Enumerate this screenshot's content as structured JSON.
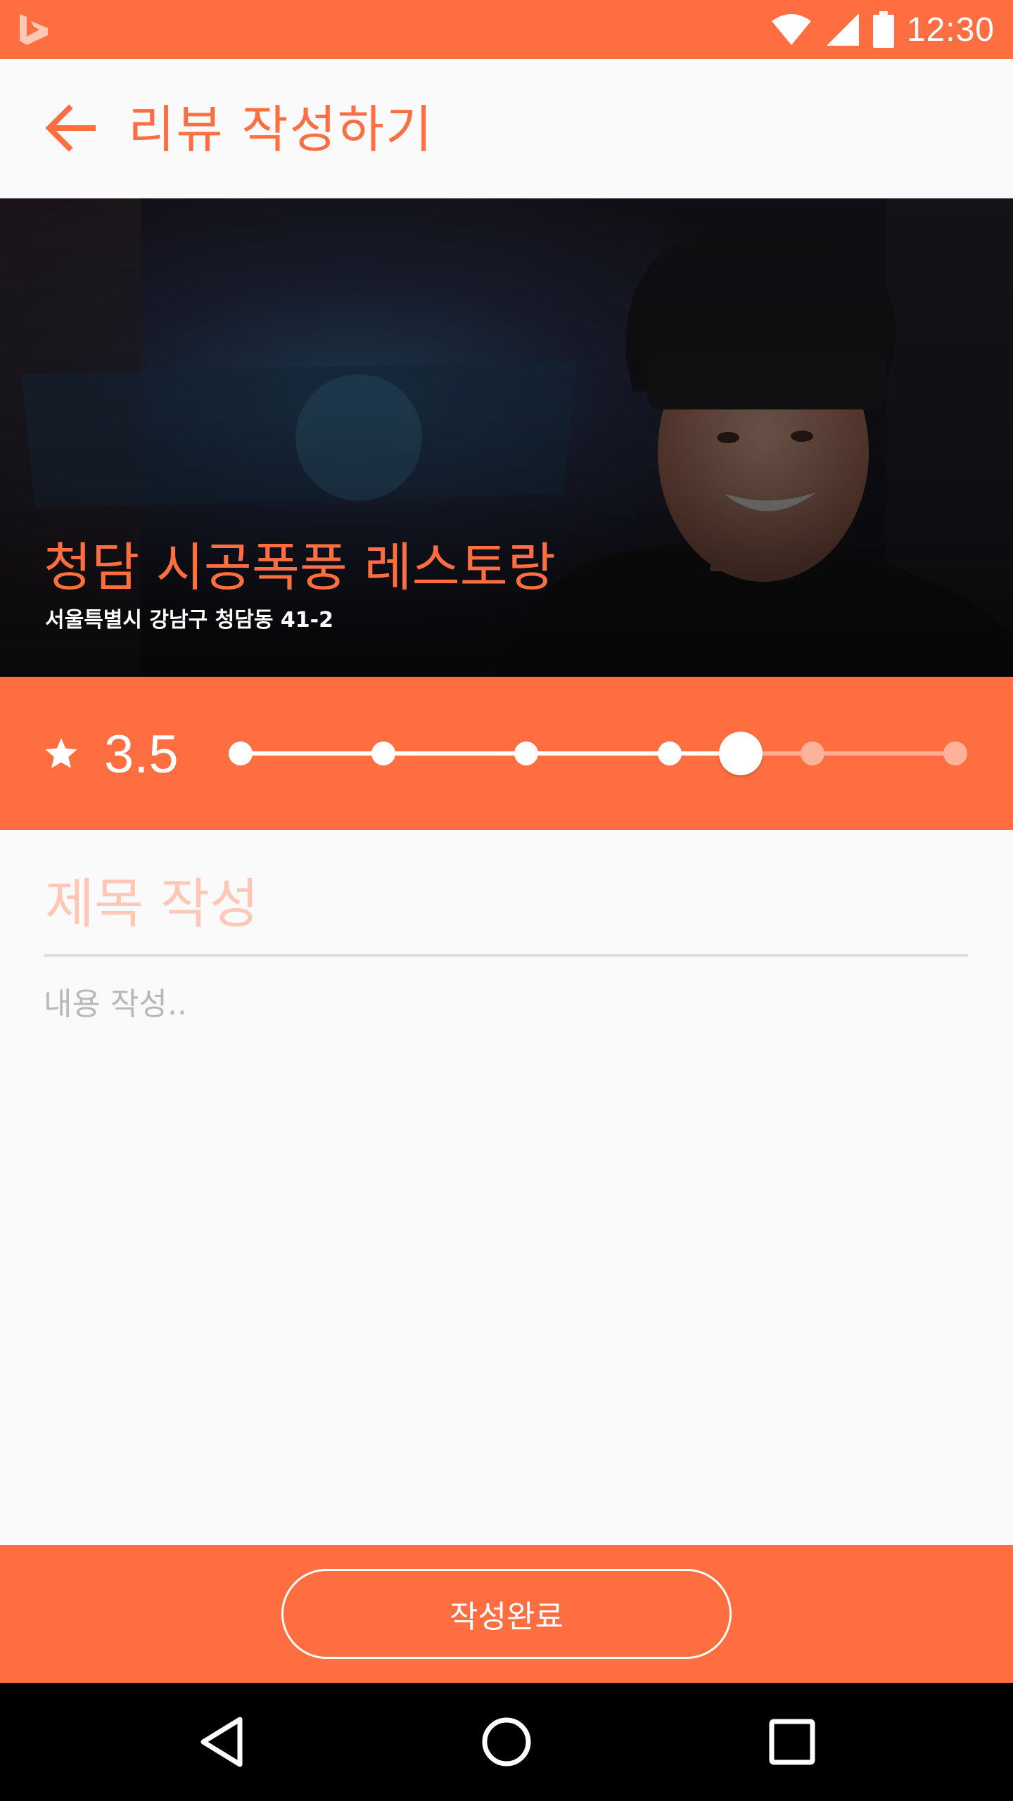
{
  "status_bar": {
    "time": "12:30",
    "icons": [
      "bing-logo-icon",
      "wifi-icon",
      "signal-icon",
      "battery-icon"
    ]
  },
  "app_bar": {
    "back_icon": "arrow-back-icon",
    "title": "리뷰 작성하기"
  },
  "restaurant": {
    "name": "청담 시공폭풍 레스토랑",
    "address": "서울특별시 강남구 청담동 41-2"
  },
  "rating": {
    "star_icon": "star-icon",
    "value_label": "3.5",
    "value": 3.5,
    "min": 0,
    "max": 5,
    "step": 1,
    "steps": [
      0,
      1,
      2,
      3,
      4,
      5
    ]
  },
  "form": {
    "title_placeholder": "제목 작성",
    "title_value": "",
    "content_placeholder": "내용 작성..",
    "content_value": ""
  },
  "submit": {
    "label": "작성완료"
  },
  "nav_bar": {
    "icons": [
      "back-triangle-icon",
      "home-circle-icon",
      "recents-square-icon"
    ]
  },
  "colors": {
    "accent": "#ff6e40",
    "title_placeholder": "#ffc7b6",
    "background": "#fafafa",
    "divider": "#dedede"
  }
}
